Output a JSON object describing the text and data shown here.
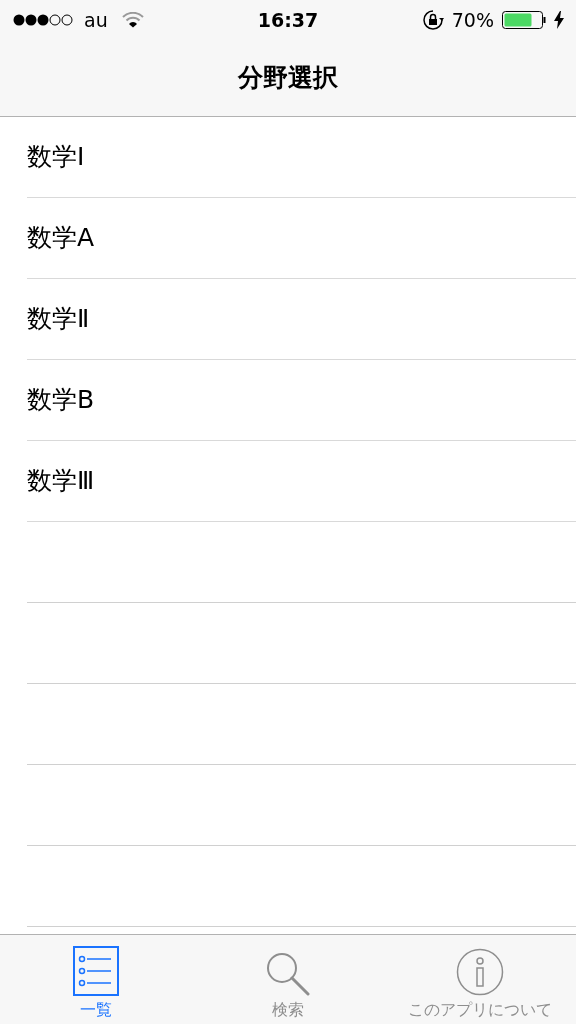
{
  "status_bar": {
    "carrier": "au",
    "time": "16:37",
    "battery_percent": "70%"
  },
  "nav_bar": {
    "title": "分野選択"
  },
  "list": {
    "items": [
      {
        "label": "数学Ⅰ"
      },
      {
        "label": "数学A"
      },
      {
        "label": "数学Ⅱ"
      },
      {
        "label": "数学B"
      },
      {
        "label": "数学Ⅲ"
      }
    ]
  },
  "tab_bar": {
    "tabs": [
      {
        "kind": "list",
        "label": "一覧",
        "selected": true
      },
      {
        "kind": "search",
        "label": "検索",
        "selected": false
      },
      {
        "kind": "info",
        "label": "このアプリについて",
        "selected": false
      }
    ]
  }
}
